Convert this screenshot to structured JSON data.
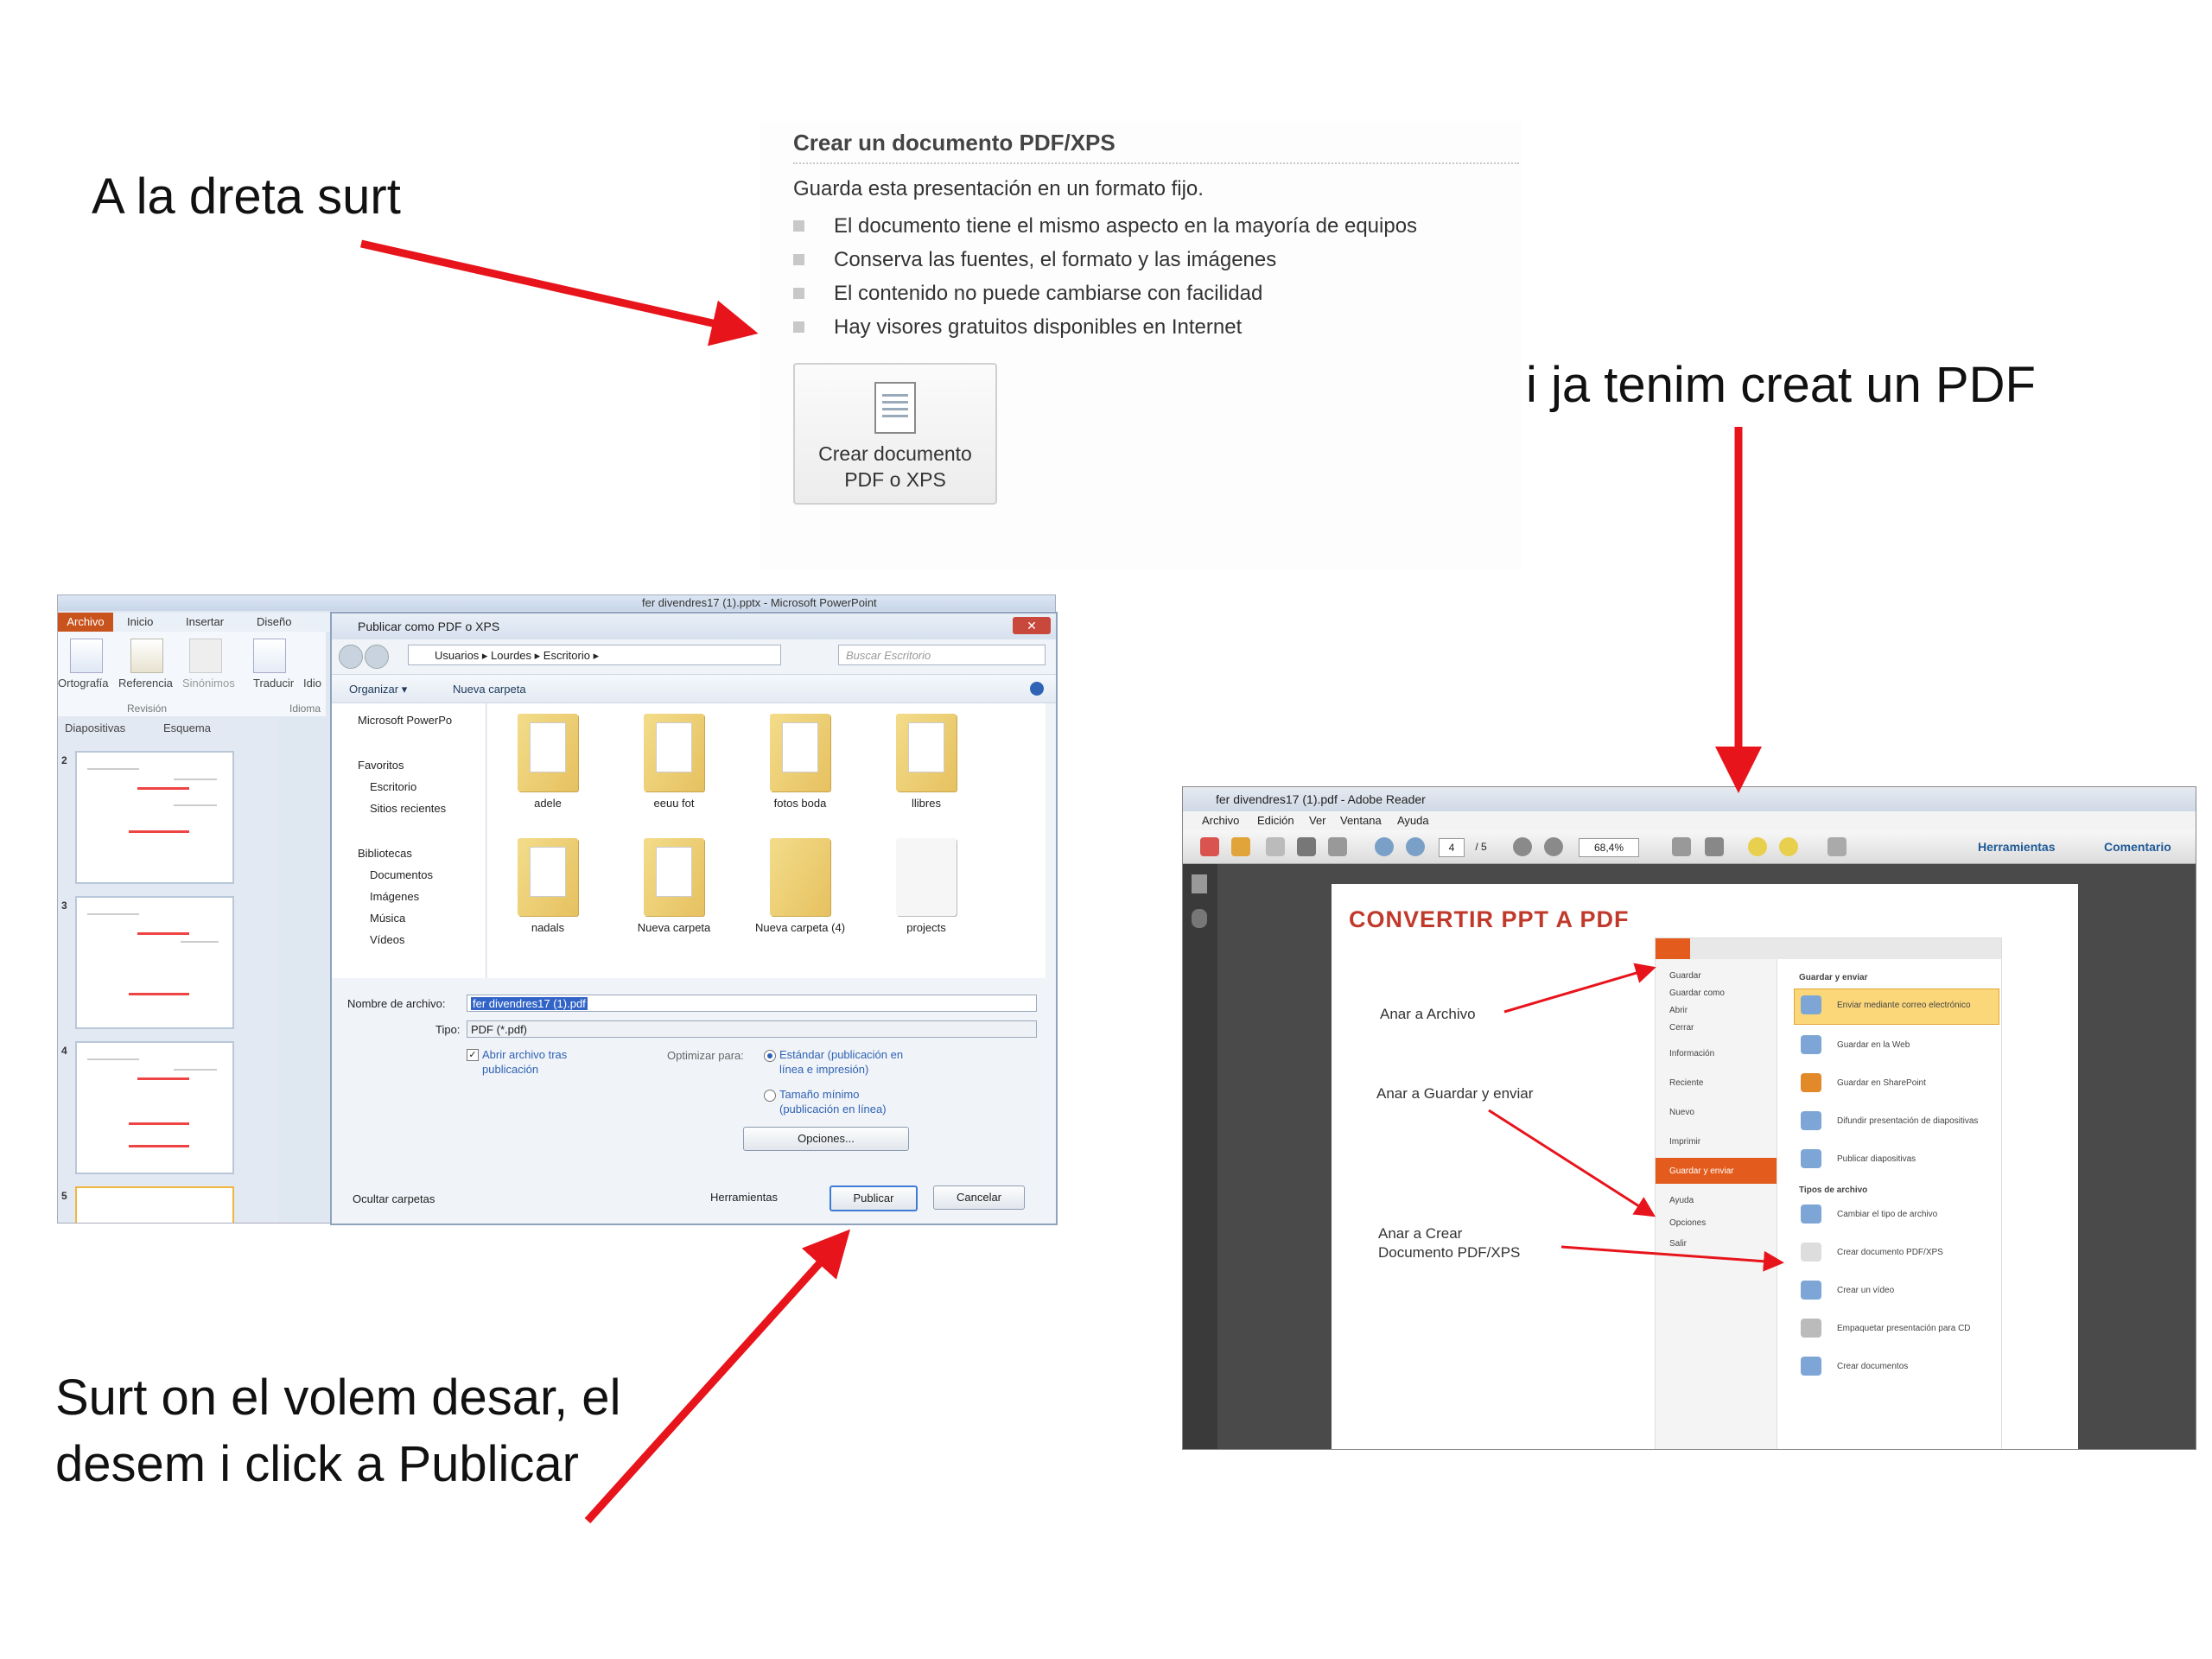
{
  "captions": {
    "top_left": "A la dreta surt",
    "top_right": "i ja tenim creat un PDF",
    "bottom_left_line1": "Surt on el volem desar, el",
    "bottom_left_line2": "desem  i click a Publicar"
  },
  "pdf_panel": {
    "title": "Crear un documento PDF/XPS",
    "description": "Guarda esta presentación en un formato fijo.",
    "bullets": [
      "El documento tiene el mismo aspecto en la mayoría de equipos",
      "Conserva las fuentes, el formato y las imágenes",
      "El contenido no puede cambiarse con facilidad",
      "Hay visores gratuitos disponibles en Internet"
    ],
    "button_line1": "Crear documento",
    "button_line2": "PDF o XPS"
  },
  "powerpoint": {
    "window_title": "fer divendres17 (1).pptx - Microsoft PowerPoint",
    "tabs": [
      "Archivo",
      "Inicio",
      "Insertar",
      "Diseño"
    ],
    "ribbon_tools": [
      "Ortografía",
      "Referencia",
      "Sinónimos",
      "Traducir",
      "Idio"
    ],
    "ribbon_groups": [
      "Revisión",
      "Idioma"
    ],
    "panel_tabs": [
      "Diapositivas",
      "Esquema"
    ],
    "slide_numbers": [
      "2",
      "3",
      "4",
      "5"
    ]
  },
  "dialog": {
    "title": "Publicar como PDF o XPS",
    "path": [
      "Usuarios",
      "Lourdes",
      "Escritorio"
    ],
    "search_placeholder": "Buscar Escritorio",
    "organize": "Organizar ▾",
    "new_folder": "Nueva carpeta",
    "nav": {
      "microsoft": "Microsoft PowerPo",
      "favoritos": "Favoritos",
      "escritorio": "Escritorio",
      "sitios": "Sitios recientes",
      "bibliotecas": "Bibliotecas",
      "documentos": "Documentos",
      "imagenes": "Imágenes",
      "musica": "Música",
      "videos": "Vídeos"
    },
    "folders": [
      "adele",
      "eeuu fot",
      "fotos boda",
      "llibres",
      "nadals",
      "Nueva carpeta",
      "Nueva carpeta (4)",
      "projects"
    ],
    "filename_label": "Nombre de archivo:",
    "filename_value": "fer divendres17 (1).pdf",
    "type_label": "Tipo:",
    "type_value": "PDF (*.pdf)",
    "open_after": "Abrir archivo tras publicación",
    "optimize_label": "Optimizar para:",
    "opt_standard": "Estándar (publicación en línea e impresión)",
    "opt_min": "Tamaño mínimo (publicación en línea)",
    "options_btn": "Opciones...",
    "hide_folders": "Ocultar carpetas",
    "tools_btn": "Herramientas",
    "publish_btn": "Publicar",
    "cancel_btn": "Cancelar"
  },
  "reader": {
    "window_title": "fer divendres17 (1).pdf - Adobe Reader",
    "menu": [
      "Archivo",
      "Edición",
      "Ver",
      "Ventana",
      "Ayuda"
    ],
    "page_current": "4",
    "page_total": "/ 5",
    "zoom": "68,4%",
    "tools_link": "Herramientas",
    "comment_link": "Comentario",
    "page_title": "CONVERTIR  PPT  A  PDF",
    "annotations": [
      "Anar a Archivo",
      "Anar a Guardar y enviar",
      "Anar a Crear",
      "Documento PDF/XPS"
    ],
    "inset_menu": [
      "Guardar",
      "Guardar como",
      "Abrir",
      "Cerrar",
      "Información",
      "Reciente",
      "Nuevo",
      "Imprimir",
      "Guardar y enviar",
      "Ayuda",
      "Opciones",
      "Salir"
    ],
    "inset_right_header": "Guardar y enviar",
    "inset_right": [
      "Enviar mediante correo electrónico",
      "Guardar en la Web",
      "Guardar en SharePoint",
      "Difundir presentación de diapositivas",
      "Publicar diapositivas"
    ],
    "inset_types_header": "Tipos de archivo",
    "inset_types": [
      "Cambiar el tipo de archivo",
      "Crear documento PDF/XPS",
      "Crear un vídeo",
      "Empaquetar presentación para CD",
      "Crear documentos"
    ]
  },
  "colors": {
    "arrow": "#e8141b",
    "accent_orange": "#e35c1e",
    "reader_title_red": "#c0392b"
  }
}
